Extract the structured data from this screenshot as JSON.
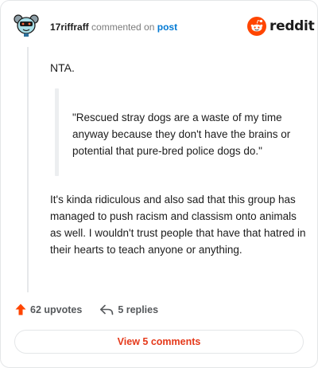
{
  "header": {
    "username": "17riffraff",
    "action": "commented on",
    "target": "post",
    "logo_text": "reddit"
  },
  "comment": {
    "intro": "NTA.",
    "quote": "\"Rescued stray dogs are a waste of my time anyway because they don't have the brains or potential that pure-bred police dogs do.\"",
    "body": "It's kinda ridiculous and also sad that this group has managed to push racism and classism onto animals as well. I wouldn't trust people that have that hatred in their hearts to teach anyone or anything."
  },
  "footer": {
    "upvotes": "62 upvotes",
    "replies": "5 replies",
    "view_comments": "View 5 comments"
  },
  "colors": {
    "brand": "#ff4500",
    "link": "#0079d3",
    "button_text": "#e5391a"
  },
  "icons": [
    "snoo-avatar-icon",
    "reddit-logo-icon",
    "upvote-arrow-icon",
    "reply-arrow-icon"
  ]
}
